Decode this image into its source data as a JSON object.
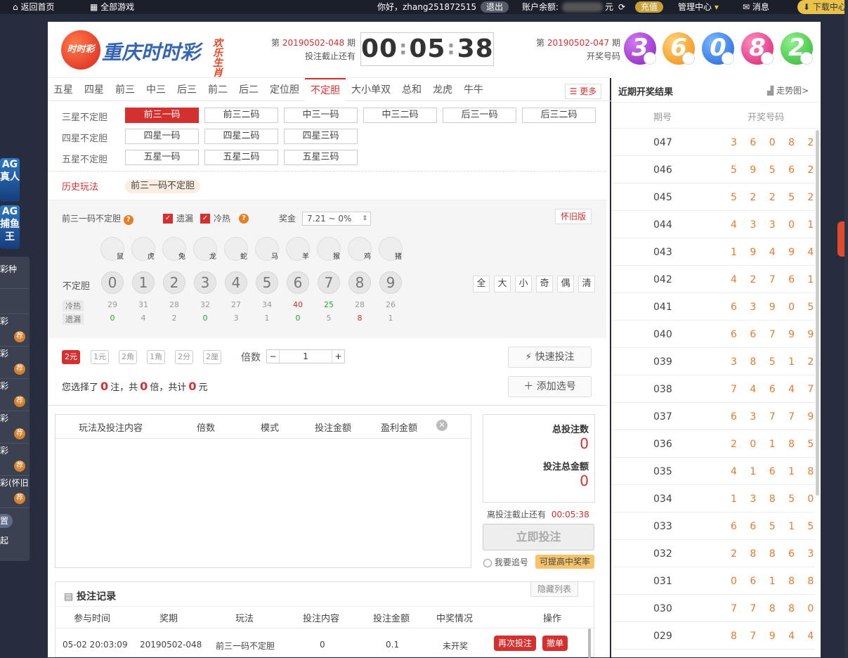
{
  "topbar": {
    "home": "返回首页",
    "all_games": "全部游戏",
    "greeting": "你好，zhang251872515",
    "logout": "退出",
    "balance_label": "账户余额:",
    "balance_unit": "元",
    "recharge": "充值",
    "manage": "管理中心",
    "messages": "消息",
    "download": "下载中心"
  },
  "sidebar": {
    "ad1": "AG 真人",
    "ad2": "AG 捕鱼王",
    "menu": [
      "彩种",
      "",
      "彩",
      "彩",
      "彩",
      "彩",
      "彩",
      "彩(怀旧)",
      "置",
      "起"
    ],
    "rec": "荐"
  },
  "header": {
    "logo_text": "时时彩",
    "title": "重庆时时彩",
    "slogan": "欢乐生肖",
    "period_prefix": "第",
    "period_current": "20190502-048",
    "period_suffix": "期",
    "deadline_label": "投注截止还有",
    "timer_h": "00",
    "timer_m": "05",
    "timer_s": "38",
    "last_period": "20190502-047",
    "last_label": "开奖号码",
    "last_numbers": [
      "3",
      "6",
      "0",
      "8",
      "2"
    ],
    "ball_colors": [
      "#a23bd3",
      "#f5a623",
      "#2f7fe6",
      "#e63a8c",
      "#4cc94c"
    ]
  },
  "tabs": [
    "五星",
    "四星",
    "前三",
    "中三",
    "后三",
    "前二",
    "后二",
    "定位胆",
    "不定胆",
    "大小单双",
    "总和",
    "龙虎",
    "牛牛"
  ],
  "active_tab": "不定胆",
  "more": "更多",
  "subplays": [
    {
      "label": "三星不定胆",
      "items": [
        "前三一码",
        "前三二码",
        "中三一码",
        "中三二码",
        "后三一码",
        "后三二码"
      ]
    },
    {
      "label": "四星不定胆",
      "items": [
        "四星一码",
        "四星二码",
        "四星三码"
      ]
    },
    {
      "label": "五星不定胆",
      "items": [
        "五星一码",
        "五星二码",
        "五星三码"
      ]
    }
  ],
  "history_label": "历史玩法",
  "history_tag": "前三一码不定胆",
  "bet": {
    "play_name": "前三一码不定胆",
    "omit": "遗漏",
    "hotcold": "冷热",
    "prize_label": "奖金",
    "prize_value": "7.21 ~ 0%",
    "old_version": "怀旧版",
    "row_label": "不定胆",
    "hot_label": "冷热",
    "miss_label": "遗漏",
    "zodiacs": [
      "鼠",
      "虎",
      "兔",
      "龙",
      "蛇",
      "马",
      "羊",
      "猴",
      "鸡",
      "猪"
    ],
    "numbers": [
      "0",
      "1",
      "2",
      "3",
      "4",
      "5",
      "6",
      "7",
      "8",
      "9"
    ],
    "hot": [
      "29",
      "31",
      "28",
      "32",
      "27",
      "34",
      "40",
      "25",
      "28",
      "26"
    ],
    "miss": [
      "0",
      "4",
      "2",
      "0",
      "3",
      "1",
      "0",
      "5",
      "8",
      "1"
    ],
    "quick": [
      "全",
      "大",
      "小",
      "奇",
      "偶",
      "清"
    ]
  },
  "units": [
    "2元",
    "1元",
    "2角",
    "1角",
    "2分",
    "2厘"
  ],
  "multiple_label": "倍数",
  "multiple_value": "1",
  "minus": "−",
  "plus": "+",
  "quick_bet": "快速投注",
  "add_sel": "添加选号",
  "summary": {
    "pre": "您选择了",
    "notes": "0",
    "mid1": "注，共",
    "times": "0",
    "mid2": "倍，共计",
    "amount": "0",
    "unit": "元"
  },
  "list_headers": [
    "玩法及投注内容",
    "倍数",
    "模式",
    "投注金额",
    "盈利金额"
  ],
  "totals": {
    "notes_label": "总投注数",
    "notes": "0",
    "amount_label": "投注总金额",
    "amount": "0"
  },
  "deadline2_label": "离投注截止还有",
  "deadline2": "00:05:38",
  "submit": "立即投注",
  "chase": "我要追号",
  "chase_hint": "可提高中奖率",
  "records": {
    "title": "投注记录",
    "hide": "隐藏列表",
    "headers": [
      "参与时间",
      "奖期",
      "玩法",
      "投注内容",
      "投注金额",
      "中奖情况",
      "操作"
    ],
    "row": [
      "05-02 20:03:09",
      "20190502-048",
      "前三一码不定胆",
      "0",
      "0.1",
      "未开奖"
    ],
    "rebet": "再次投注",
    "cancel": "撤单"
  },
  "results": {
    "title": "近期开奖结果",
    "trend": "走势图>",
    "col_period": "期号",
    "col_numbers": "开奖号码",
    "rows": [
      [
        "047",
        "3 6 0 8 2"
      ],
      [
        "046",
        "5 9 5 6 2"
      ],
      [
        "045",
        "5 2 2 5 2"
      ],
      [
        "044",
        "4 3 3 0 1"
      ],
      [
        "043",
        "1 9 4 9 4"
      ],
      [
        "042",
        "4 2 7 6 1"
      ],
      [
        "041",
        "6 3 9 0 5"
      ],
      [
        "040",
        "6 6 7 9 9"
      ],
      [
        "039",
        "3 8 5 1 2"
      ],
      [
        "038",
        "7 4 6 4 7"
      ],
      [
        "037",
        "6 3 7 7 9"
      ],
      [
        "036",
        "2 0 1 8 5"
      ],
      [
        "035",
        "4 1 6 1 8"
      ],
      [
        "034",
        "1 3 8 5 0"
      ],
      [
        "033",
        "6 6 5 1 5"
      ],
      [
        "032",
        "2 8 8 6 3"
      ],
      [
        "031",
        "0 6 1 8 8"
      ],
      [
        "030",
        "7 7 8 8 0"
      ],
      [
        "029",
        "8 7 9 4 4"
      ]
    ]
  }
}
